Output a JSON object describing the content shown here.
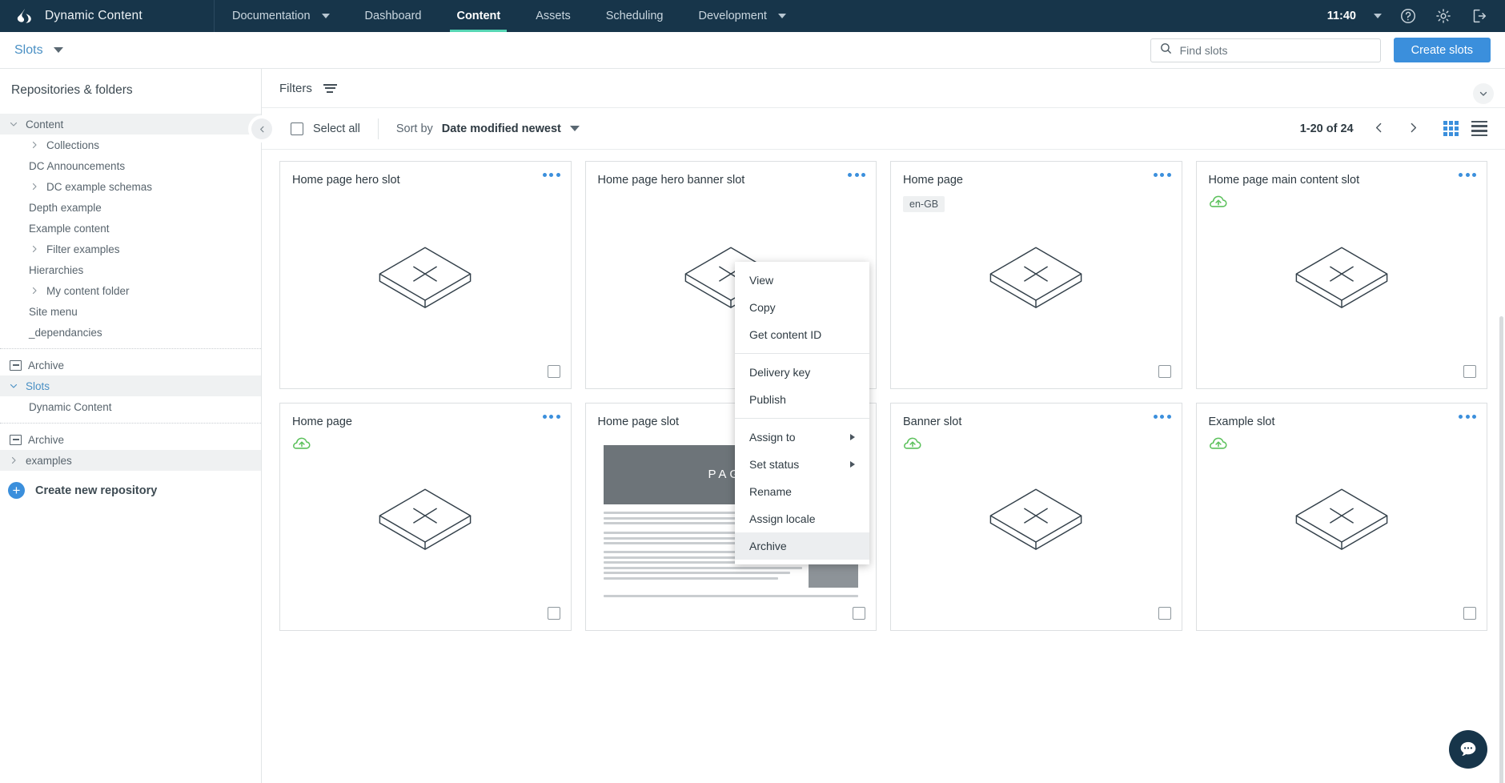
{
  "topnav": {
    "brand": "Dynamic Content",
    "logo_icon": "amplience-logo-icon",
    "items": [
      {
        "label": "Documentation",
        "has_caret": true,
        "active": false
      },
      {
        "label": "Dashboard",
        "has_caret": false,
        "active": false
      },
      {
        "label": "Content",
        "has_caret": false,
        "active": true
      },
      {
        "label": "Assets",
        "has_caret": false,
        "active": false
      },
      {
        "label": "Scheduling",
        "has_caret": false,
        "active": false
      },
      {
        "label": "Development",
        "has_caret": true,
        "active": false
      }
    ],
    "clock": "11:40",
    "right_icons": [
      "chevron-down-icon",
      "help-icon",
      "gear-icon",
      "logout-icon"
    ],
    "accent_underline": "#57d6b4",
    "bg": "#17354a"
  },
  "subbar": {
    "dropdown_label": "Slots",
    "dropdown_icon": "chevron-down-icon",
    "search": {
      "placeholder": "Find slots",
      "value": "",
      "icon": "search-icon"
    },
    "create_button": "Create slots",
    "create_button_color": "#3b8fdc"
  },
  "sidebar": {
    "title": "Repositories & folders",
    "tree": [
      {
        "label": "Content",
        "icon": "chevron-expanded-icon",
        "level": 0,
        "selected": true,
        "blue": false
      },
      {
        "label": "Collections",
        "icon": "chevron-collapsed-icon",
        "level": 1,
        "selected": false,
        "blue": false
      },
      {
        "label": "DC Announcements",
        "icon": "none",
        "level": 1,
        "selected": false,
        "blue": false
      },
      {
        "label": "DC example schemas",
        "icon": "chevron-collapsed-icon",
        "level": 1,
        "selected": false,
        "blue": false
      },
      {
        "label": "Depth example",
        "icon": "none",
        "level": 1,
        "selected": false,
        "blue": false
      },
      {
        "label": "Example content",
        "icon": "none",
        "level": 1,
        "selected": false,
        "blue": false
      },
      {
        "label": "Filter examples",
        "icon": "chevron-collapsed-icon",
        "level": 1,
        "selected": false,
        "blue": false
      },
      {
        "label": "Hierarchies",
        "icon": "none",
        "level": 1,
        "selected": false,
        "blue": false
      },
      {
        "label": "My content folder",
        "icon": "chevron-collapsed-icon",
        "level": 1,
        "selected": false,
        "blue": false
      },
      {
        "label": "Site menu",
        "icon": "none",
        "level": 1,
        "selected": false,
        "blue": false
      },
      {
        "label": "_dependancies",
        "icon": "none",
        "level": 1,
        "selected": false,
        "blue": false
      },
      {
        "label": "__SEPARATOR__",
        "icon": "none",
        "level": 0,
        "selected": false,
        "blue": false
      },
      {
        "label": "Archive",
        "icon": "archive-box-icon",
        "level": 0,
        "selected": false,
        "blue": false
      },
      {
        "label": "Slots",
        "icon": "chevron-expanded-icon",
        "level": 0,
        "selected": true,
        "blue": true
      },
      {
        "label": "Dynamic Content",
        "icon": "none",
        "level": 1,
        "selected": false,
        "blue": false
      },
      {
        "label": "__SEPARATOR__",
        "icon": "none",
        "level": 0,
        "selected": false,
        "blue": false
      },
      {
        "label": "Archive",
        "icon": "archive-box-icon",
        "level": 0,
        "selected": false,
        "blue": false
      },
      {
        "label": "examples",
        "icon": "chevron-collapsed-icon",
        "level": 0,
        "selected": true,
        "blue": false
      }
    ],
    "create_repo": {
      "label": "Create new repository",
      "icon": "plus-circle-icon"
    }
  },
  "filters": {
    "label": "Filters",
    "icon": "filter-icon",
    "collapse_panel_icon": "chevron-down-icon"
  },
  "list_toolbar": {
    "collapse_sidebar_icon": "chevron-left-icon",
    "select_all_label": "Select all",
    "select_all_checked": false,
    "sort_by_label": "Sort by",
    "sort_by_value": "Date modified newest",
    "sort_caret_icon": "chevron-down-icon",
    "pagination_text": "1-20 of 24",
    "prev_icon": "chevron-left-icon",
    "next_icon": "chevron-right-icon",
    "grid_view_icon": "grid-view-icon",
    "list_view_icon": "list-view-icon",
    "active_view": "grid"
  },
  "cards": [
    {
      "title": "Home page hero slot",
      "locale": "",
      "published": false,
      "thumb": "isometric-slot-icon",
      "menu_open": true
    },
    {
      "title": "Home page hero banner slot",
      "locale": "",
      "published": false,
      "thumb": "isometric-slot-icon",
      "menu_open": false
    },
    {
      "title": "Home page",
      "locale": "en-GB",
      "published": false,
      "thumb": "isometric-slot-icon",
      "menu_open": false
    },
    {
      "title": "Home page main content slot",
      "locale": "",
      "published": true,
      "thumb": "isometric-slot-icon",
      "menu_open": false
    },
    {
      "title": "Home page",
      "locale": "",
      "published": true,
      "thumb": "isometric-slot-icon",
      "menu_open": false
    },
    {
      "title": "Home page slot",
      "locale": "",
      "published": false,
      "thumb": "page-preview",
      "menu_open": false
    },
    {
      "title": "Banner slot",
      "locale": "",
      "published": true,
      "thumb": "isometric-slot-icon",
      "menu_open": false
    },
    {
      "title": "Example slot",
      "locale": "",
      "published": true,
      "thumb": "isometric-slot-icon",
      "menu_open": false
    }
  ],
  "preview_card": {
    "hero_word": "PAGE",
    "paragraph_count": 3
  },
  "context_menu": {
    "groups": [
      [
        {
          "label": "View",
          "submenu": false,
          "highlight": false
        },
        {
          "label": "Copy",
          "submenu": false,
          "highlight": false
        },
        {
          "label": "Get content ID",
          "submenu": false,
          "highlight": false
        }
      ],
      [
        {
          "label": "Delivery key",
          "submenu": false,
          "highlight": false
        },
        {
          "label": "Publish",
          "submenu": false,
          "highlight": false
        }
      ],
      [
        {
          "label": "Assign to",
          "submenu": true,
          "highlight": false
        },
        {
          "label": "Set status",
          "submenu": true,
          "highlight": false
        },
        {
          "label": "Rename",
          "submenu": false,
          "highlight": false
        },
        {
          "label": "Assign locale",
          "submenu": false,
          "highlight": false
        },
        {
          "label": "Archive",
          "submenu": false,
          "highlight": true
        }
      ]
    ]
  },
  "chat": {
    "icon": "chat-bubble-icon"
  },
  "colors": {
    "header_bg": "#17354a",
    "accent_teal": "#57d6b4",
    "primary_blue": "#3b8fdc",
    "link_blue": "#4a90c4",
    "published_green": "#5cc15c"
  }
}
